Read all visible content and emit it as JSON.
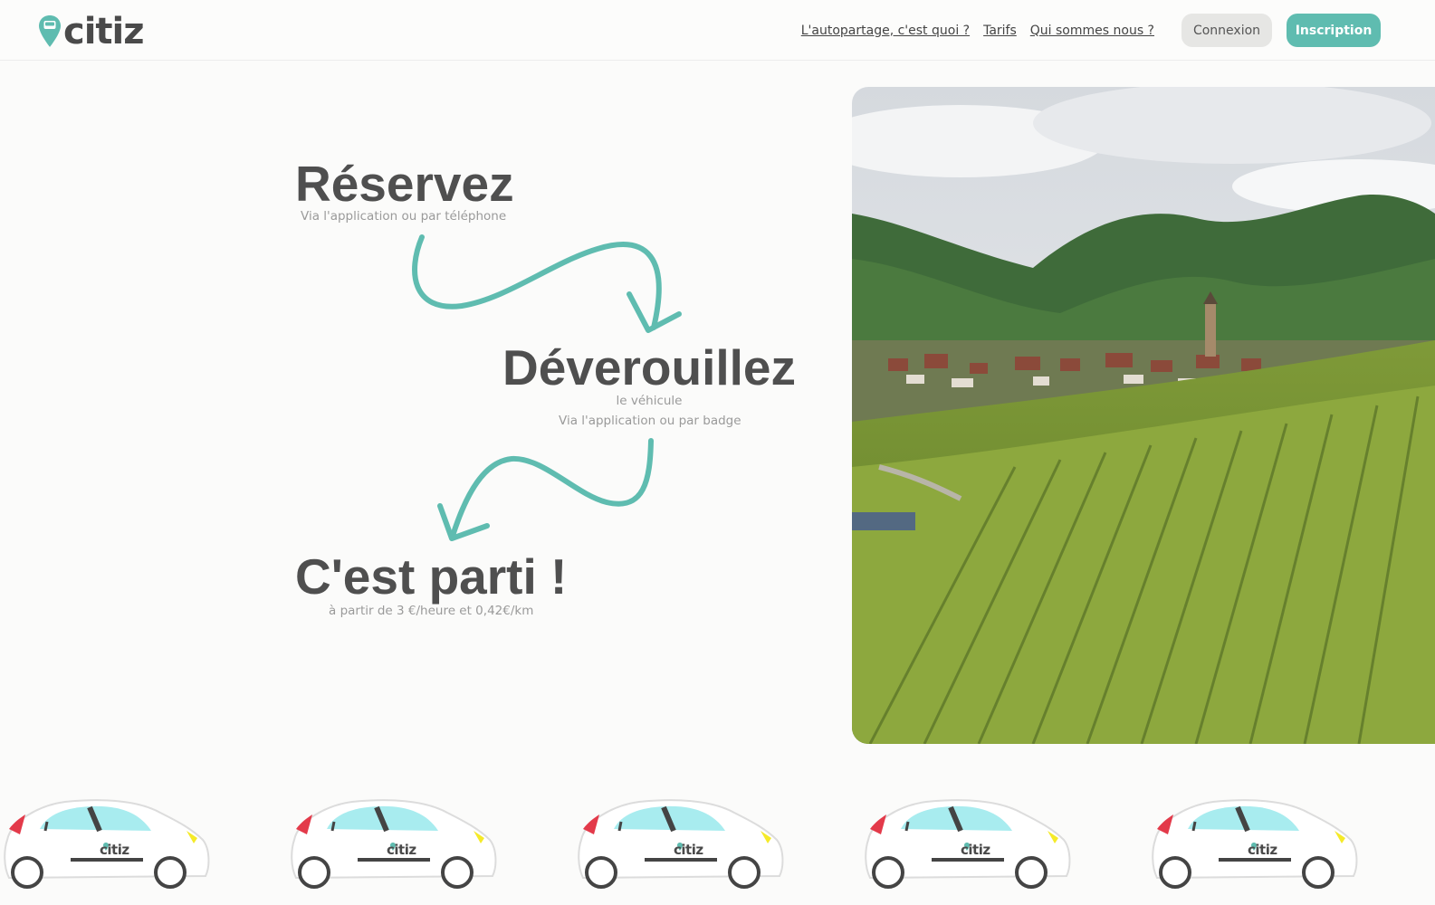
{
  "brand": {
    "name": "citiz",
    "accent": "#5fbcb0",
    "text_color": "#4a4a4a"
  },
  "nav": {
    "links": [
      "L'autopartage, c'est quoi ?",
      "Tarifs",
      "Qui sommes nous ?"
    ],
    "login_label": "Connexion",
    "signup_label": "Inscription"
  },
  "steps": [
    {
      "title": "Réservez",
      "subtitle": [
        "Via l'application ou par téléphone"
      ]
    },
    {
      "title": "Déverouillez",
      "subtitle": [
        "le véhicule",
        "Via l'application ou par badge"
      ]
    },
    {
      "title": "C'est parti !",
      "subtitle": [
        "à partir de 3 €/heure et 0,42€/km"
      ]
    }
  ],
  "hero_image": {
    "subject": "vineyard-village-landscape"
  },
  "cars": [
    {
      "brand": "citiz"
    },
    {
      "brand": "citiz"
    },
    {
      "brand": "citiz"
    },
    {
      "brand": "citiz"
    },
    {
      "brand": "citiz"
    }
  ]
}
